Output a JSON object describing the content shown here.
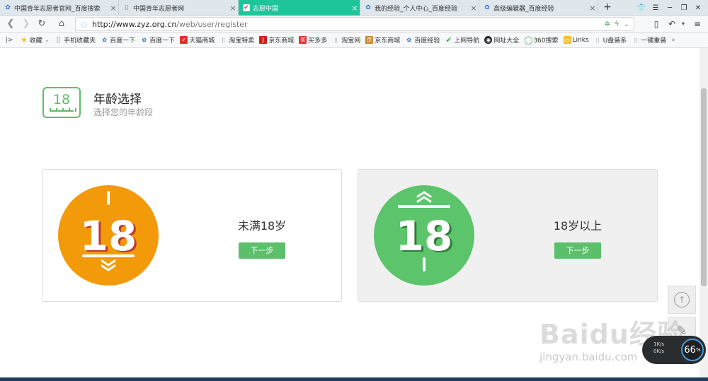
{
  "tabs": [
    {
      "title": "中国青年志愿者官网_百度搜索",
      "icon": "paw-icon",
      "active": false
    },
    {
      "title": "中国青年志愿者网",
      "icon": "page-icon",
      "active": false
    },
    {
      "title": "志愿中国",
      "icon": "heart-check-icon",
      "active": true
    },
    {
      "title": "我的经验_个人中心_百度经验",
      "icon": "paw-icon",
      "active": false
    },
    {
      "title": "高级编辑器_百度经验",
      "icon": "paw-icon",
      "active": false
    }
  ],
  "new_tab_label": "+",
  "address": {
    "url_host": "http://www.zyz.org.cn",
    "url_path": "/web/user/register"
  },
  "bookmarks": [
    {
      "label": "收藏",
      "icon": "star-icon",
      "color": "#f5c518"
    },
    {
      "label": "手机收藏夹",
      "icon": "phone-icon",
      "color": "#3cae4c"
    },
    {
      "label": "百度一下",
      "icon": "paw-icon",
      "color": "#3070d8"
    },
    {
      "label": "百度一下",
      "icon": "paw-icon",
      "color": "#3070d8"
    },
    {
      "label": "天猫商城",
      "icon": "tmall-icon",
      "color": "#e03030"
    },
    {
      "label": "淘宝特卖",
      "icon": "page-icon",
      "color": "#999999"
    },
    {
      "label": "京东商城",
      "icon": "jd-icon",
      "color": "#d0201a"
    },
    {
      "label": "买多多",
      "icon": "buy-icon",
      "color": "#e03030"
    },
    {
      "label": "淘宝网",
      "icon": "page-icon",
      "color": "#999999"
    },
    {
      "label": "京东商城",
      "icon": "shop-icon",
      "color": "#c8862a"
    },
    {
      "label": "百度经验",
      "icon": "paw-icon",
      "color": "#3070d8"
    },
    {
      "label": "上网导航",
      "icon": "check-icon",
      "color": "#3cae4c"
    },
    {
      "label": "网址大全",
      "icon": "globe-icon",
      "color": "#222222"
    },
    {
      "label": "360搜索",
      "icon": "circle-icon",
      "color": "#3cae4c"
    },
    {
      "label": "Links",
      "icon": "folder-icon",
      "color": "#f0c040"
    },
    {
      "label": "U盘装系",
      "icon": "page-icon",
      "color": "#999999"
    },
    {
      "label": "一键重装",
      "icon": "page-icon",
      "color": "#999999"
    }
  ],
  "page": {
    "icon_number": "18",
    "heading": "年龄选择",
    "subheading": "选择您的年龄段"
  },
  "cards": [
    {
      "badge": "18",
      "label": "未满18岁",
      "button": "下一步",
      "color": "#f39a0a"
    },
    {
      "badge": "18",
      "label": "18岁以上",
      "button": "下一步",
      "color": "#5cc46a"
    }
  ],
  "watermark": {
    "main": "Baidu经验",
    "sub": "jingyan.baidu.com"
  },
  "net_widget": {
    "percent": "66",
    "unit": "%",
    "up": "1K/s",
    "down": "0K/s"
  }
}
